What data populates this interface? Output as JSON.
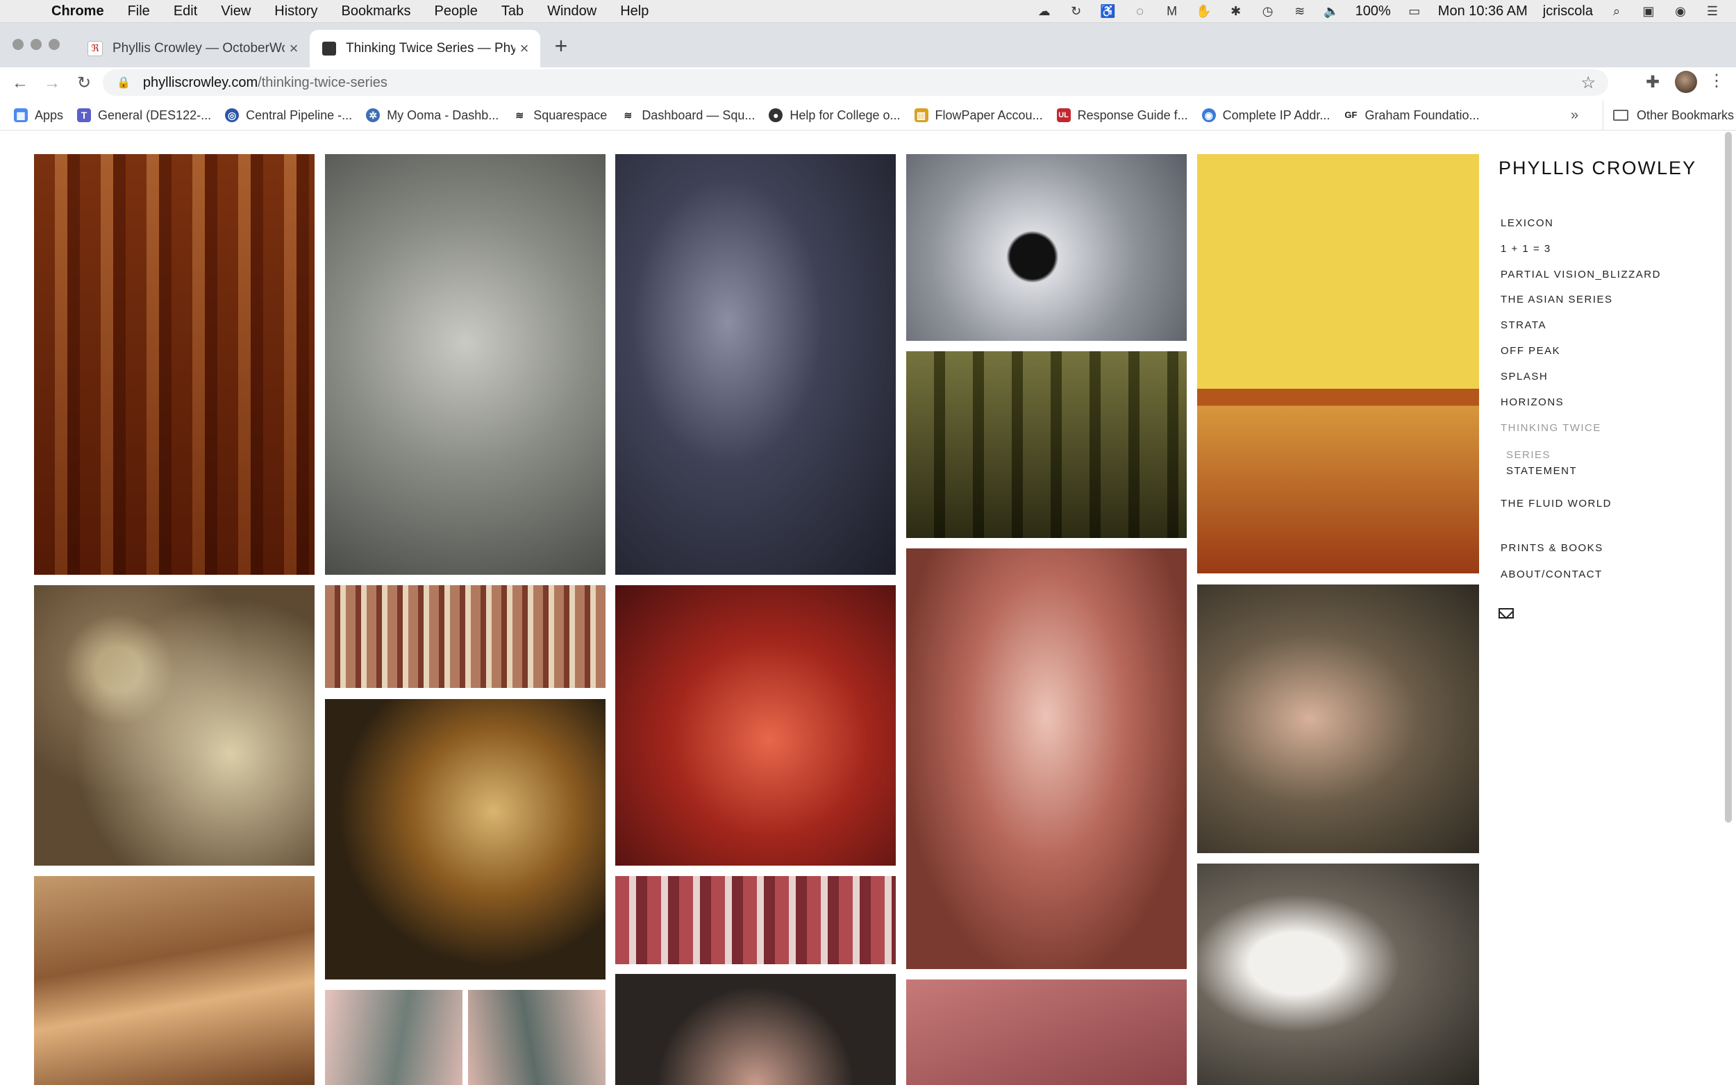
{
  "menubar": {
    "app": "Chrome",
    "items": [
      "File",
      "Edit",
      "View",
      "History",
      "Bookmarks",
      "People",
      "Tab",
      "Window",
      "Help"
    ],
    "battery": "100%",
    "clock": "Mon 10:36 AM",
    "user": "jcriscola"
  },
  "tabs": [
    {
      "title": "Phyllis Crowley — OctoberWorks",
      "active": false
    },
    {
      "title": "Thinking Twice Series — Phyllis Crowley",
      "active": true
    }
  ],
  "omnibox": {
    "host": "phylliscrowley.com",
    "path": "/thinking-twice-series"
  },
  "bookmarks": [
    {
      "label": "Apps",
      "color": "#4a8af4",
      "glyph": "▦"
    },
    {
      "label": "General (DES122-...",
      "color": "#5b5fc7",
      "glyph": "T"
    },
    {
      "label": "Central Pipeline -...",
      "color": "#2b57a8",
      "glyph": "◎"
    },
    {
      "label": "My Ooma - Dashb...",
      "color": "#3b6fb6",
      "glyph": "✲"
    },
    {
      "label": "Squarespace",
      "color": "#222222",
      "glyph": "≋"
    },
    {
      "label": "Dashboard — Squ...",
      "color": "#222222",
      "glyph": "≋"
    },
    {
      "label": "Help for College o...",
      "color": "#333333",
      "glyph": "●"
    },
    {
      "label": "FlowPaper Accou...",
      "color": "#d9a021",
      "glyph": "▥"
    },
    {
      "label": "Response Guide f...",
      "color": "#c4262e",
      "glyph": "UL"
    },
    {
      "label": "Complete IP Addr...",
      "color": "#3a7bd5",
      "glyph": "◉"
    },
    {
      "label": "Graham Foundatio...",
      "color": "#ffffff",
      "glyph": "GF"
    }
  ],
  "bookmarks_more": "»",
  "other_bookmarks": "Other Bookmarks",
  "site": {
    "title": "PHYLLIS CROWLEY",
    "nav": [
      {
        "label": "LEXICON"
      },
      {
        "label": "1 + 1 = 3"
      },
      {
        "label": "PARTIAL VISION_BLIZZARD"
      },
      {
        "label": "THE ASIAN SERIES"
      },
      {
        "label": "STRATA"
      },
      {
        "label": "OFF PEAK"
      },
      {
        "label": "SPLASH"
      },
      {
        "label": "HORIZONS"
      },
      {
        "label": "THINKING TWICE"
      }
    ],
    "sub_nav": [
      {
        "label": "SERIES"
      },
      {
        "label": "STATEMENT"
      }
    ],
    "nav_after": [
      {
        "label": "THE FLUID WORLD"
      }
    ],
    "nav_footer": [
      {
        "label": "PRINTS & BOOKS"
      },
      {
        "label": "ABOUT/CONTACT"
      }
    ]
  },
  "gallery_colors": {
    "accent": "#111111",
    "active_nav": "#9a9a9a"
  }
}
